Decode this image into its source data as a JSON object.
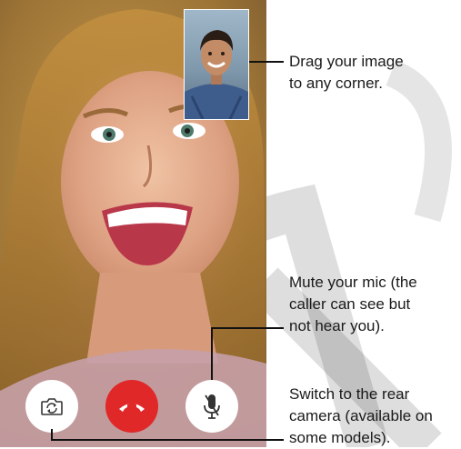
{
  "controls": [
    {
      "name": "switch-camera-button",
      "icon": "camera-flip-icon",
      "color": "#ffffff"
    },
    {
      "name": "end-call-button",
      "icon": "phone-hangup-icon",
      "color": "#e02828"
    },
    {
      "name": "mute-button",
      "icon": "microphone-icon",
      "color": "#ffffff"
    }
  ],
  "callouts": {
    "pip": {
      "lines": [
        "Drag your image",
        "to any corner."
      ]
    },
    "mute": {
      "lines": [
        "Mute your mic (the",
        "caller can see but",
        "not hear you)."
      ]
    },
    "flip": {
      "lines": [
        "Switch to the rear",
        "camera (available on",
        "some models)."
      ]
    }
  }
}
